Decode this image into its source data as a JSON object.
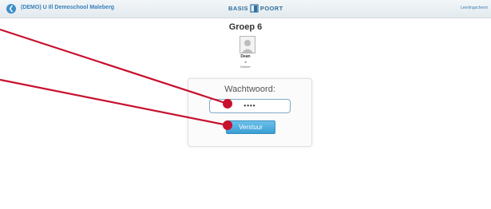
{
  "header": {
    "back_icon": "back-arrow-icon",
    "school_name": "(DEMO) U Ill Demoschool Maleberg",
    "logo_left": "BASIS",
    "logo_right": "POORT",
    "logout_label": "Leerlingscherm"
  },
  "page": {
    "group_title": "Groep 6",
    "student": {
      "avatar_icon": "user-avatar-icon",
      "name": "Dean",
      "line2": "di",
      "line3": "Dekker"
    }
  },
  "login": {
    "password_label": "Wachtwoord:",
    "password_value": "••••",
    "submit_label": "Verstuur"
  },
  "annotations": {
    "color": "#c8102e",
    "marker_shape": "dot-with-line"
  }
}
